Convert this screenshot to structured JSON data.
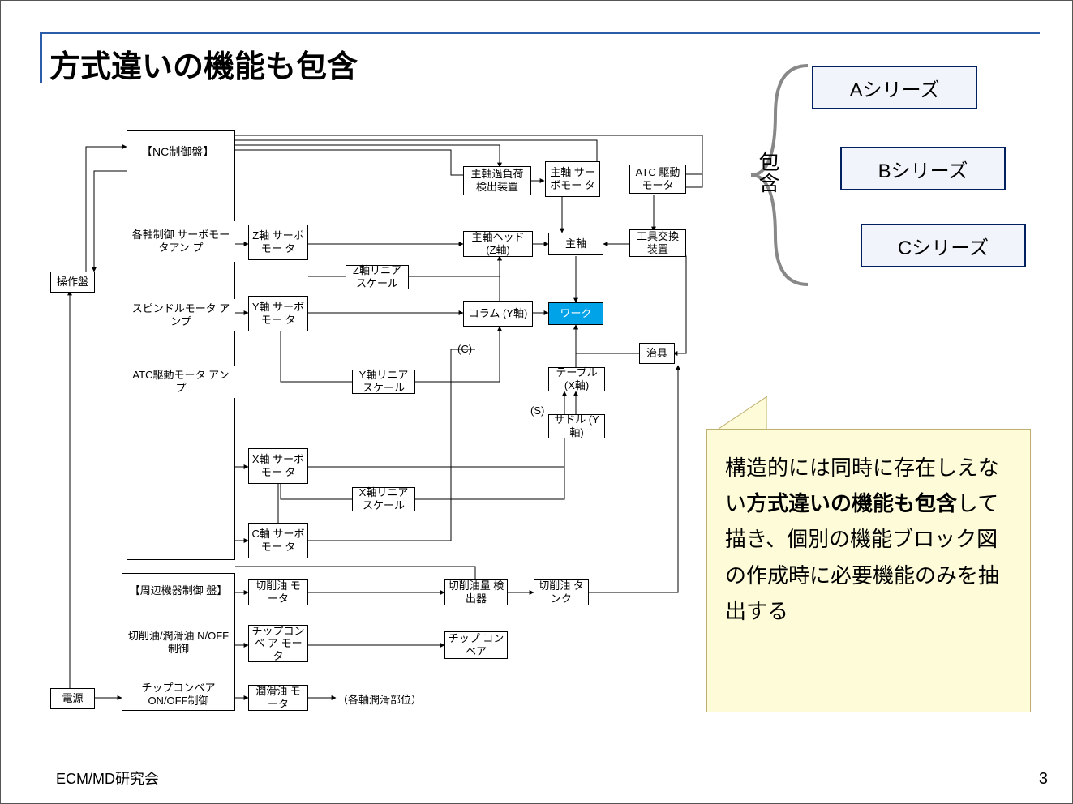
{
  "title": "方式違いの機能も包含",
  "footer_left": "ECM/MD研究会",
  "footer_right": "3",
  "series": {
    "a": "Aシリーズ",
    "b": "Bシリーズ",
    "c": "Cシリーズ"
  },
  "inclusion_label": "包含",
  "callout": {
    "t1": "構造的には同時に存在しえない",
    "t2": "方式違いの機能も包含",
    "t3": "して描き、個別の機能ブロック図の作成時に必要機能のみを抽出する"
  },
  "nodes": {
    "souban": "操作盤",
    "nc_panel": "【NC制御盤】",
    "servamp": "各軸制御\nサーボモータアン\nプ",
    "spindle_amp": "スピンドルモータ\nアンプ",
    "atc_amp": "ATC駆動モータ\nアンプ",
    "z_servo": "Z軸\nサーボモー\nタ",
    "z_linear": "Z軸リニア\nスケール",
    "y_servo": "Y軸\nサーボモー\nタ",
    "y_linear": "Y軸リニア\nスケール",
    "x_servo": "X軸\nサーボモー\nタ",
    "x_linear": "X軸リニア\nスケール",
    "c_servo": "C軸\nサーボモー\nタ",
    "overload": "主軸過負荷\n検出装置",
    "spindle_servo": "主軸\nサーボモー\nタ",
    "atc_motor": "ATC\n駆動モータ",
    "z_head": "主軸ヘッド\n(Z軸)",
    "spindle": "主軸",
    "tool_change": "工具交換\n装置",
    "column": "コラム\n(Y軸)",
    "work": "ワーク",
    "jig": "治具",
    "table": "テーブル\n(X軸)",
    "saddle": "サドル\n(Y軸)",
    "periph_panel": "【周辺機器制御\n盤】",
    "cool_onoff": "切削油/潤滑油\nN/OFF制御",
    "chip_onoff": "チップコンベア\nON/OFF制御",
    "cool_motor": "切削油\nモータ",
    "chip_motor": "チップコンベ\nア\nモータ",
    "lube_motor": "潤滑油\nモータ",
    "cool_detect": "切削油量\n検出器",
    "cool_tank": "切削油\nタンク",
    "chip_conv": "チップ\nコンベア",
    "power": "電源",
    "lube_target": "（各軸潤滑部位）",
    "c_label": "(C)",
    "s_label": "(S)"
  }
}
